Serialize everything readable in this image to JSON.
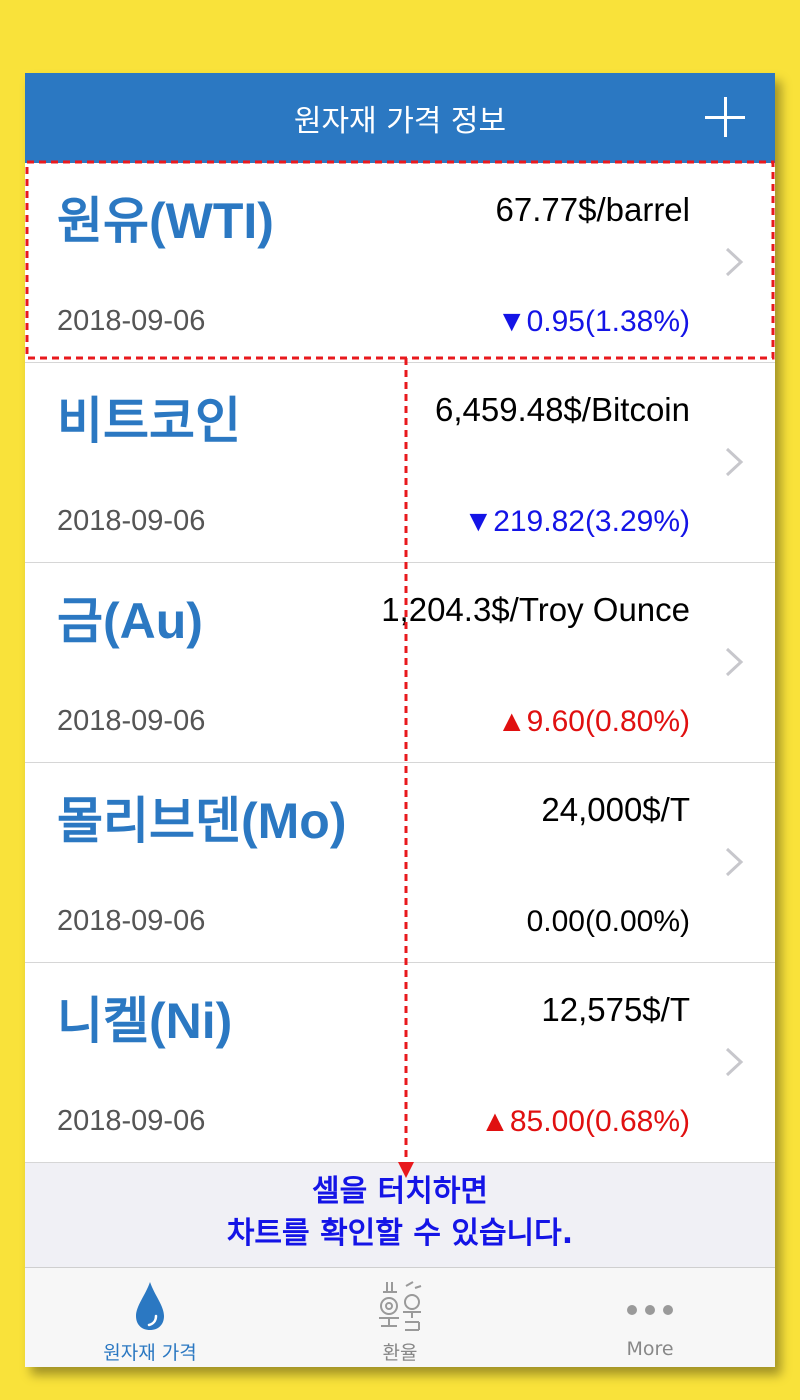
{
  "header": {
    "title": "원자재 가격 정보"
  },
  "colors": {
    "accent": "#2b78c2",
    "down": "#1414e6",
    "up": "#e01010",
    "background": "#f9e23a"
  },
  "items": [
    {
      "name": "원유(WTI)",
      "price": "67.77$/barrel",
      "date": "2018-09-06",
      "direction": "down",
      "arrow": "▼",
      "change": "0.95(1.38%)"
    },
    {
      "name": "비트코인",
      "price": "6,459.48$/Bitcoin",
      "date": "2018-09-06",
      "direction": "down",
      "arrow": "▼",
      "change": "219.82(3.29%)"
    },
    {
      "name": "금(Au)",
      "price": "1,204.3$/Troy Ounce",
      "date": "2018-09-06",
      "direction": "up",
      "arrow": "▲",
      "change": "9.60(0.80%)"
    },
    {
      "name": "몰리브덴(Mo)",
      "price": "24,000$/T",
      "date": "2018-09-06",
      "direction": "flat",
      "arrow": "",
      "change": "0.00(0.00%)"
    },
    {
      "name": "니켈(Ni)",
      "price": "12,575$/T",
      "date": "2018-09-06",
      "direction": "up",
      "arrow": "▲",
      "change": "85.00(0.68%)"
    }
  ],
  "hint": {
    "line1": "셀을 터치하면",
    "line2": "차트를 확인할 수 있습니다."
  },
  "tabs": [
    {
      "label": "원자재 가격",
      "icon": "drop-icon",
      "active": true
    },
    {
      "label": "환율",
      "icon": "exchange-icon",
      "active": false
    },
    {
      "label": "More",
      "icon": "more-dots-icon",
      "active": false
    }
  ]
}
